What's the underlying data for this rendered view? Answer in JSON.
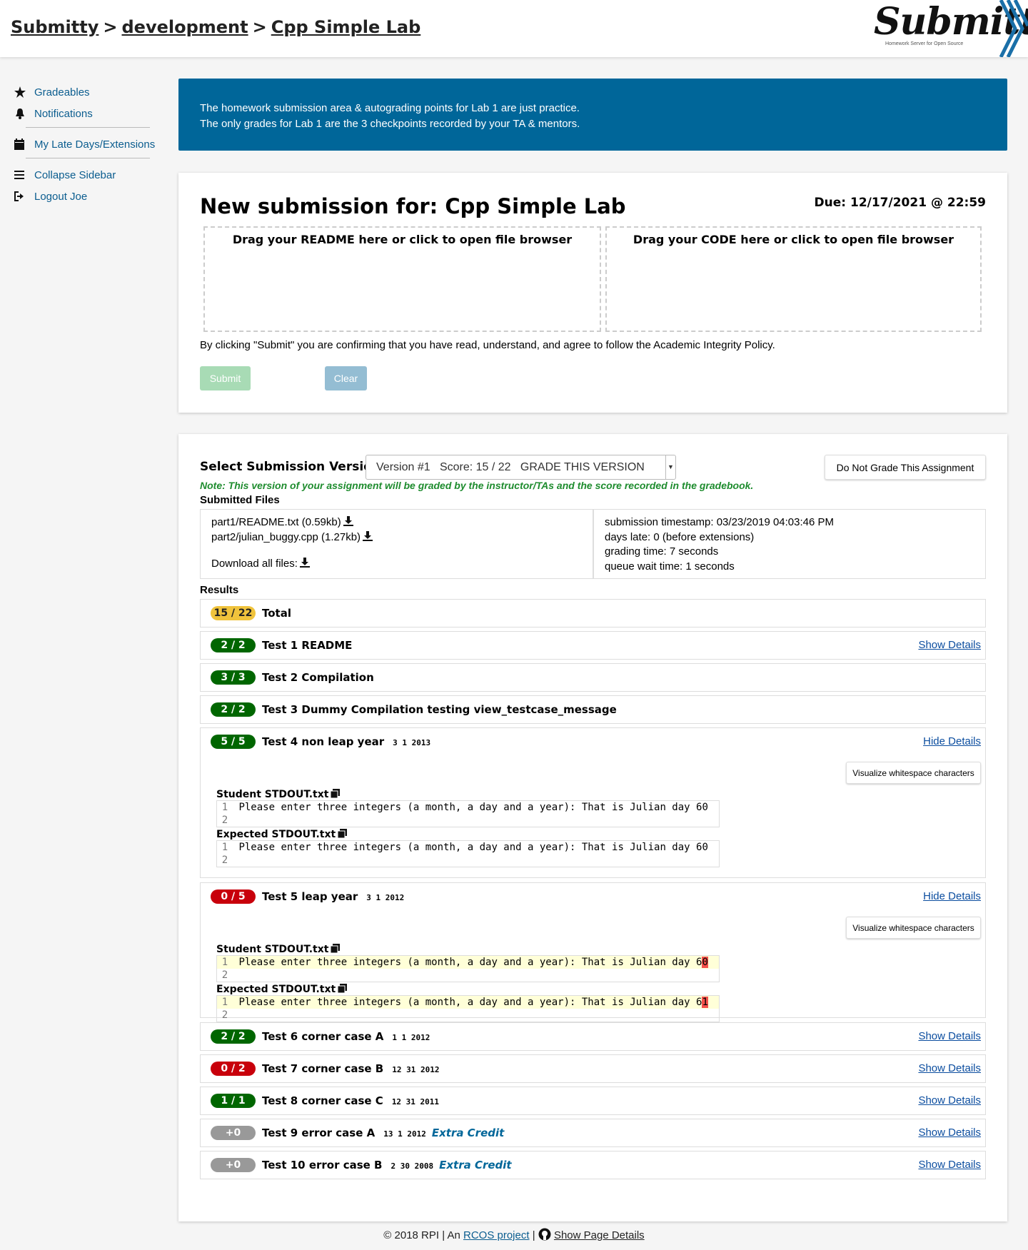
{
  "breadcrumb": {
    "course_site": "Submitty",
    "course": "development",
    "gradeable": "Cpp Simple Lab",
    "separator": ">"
  },
  "logo": {
    "text": "Submitty",
    "tagline": "Homework Server for Open Source"
  },
  "sidebar": {
    "items": [
      {
        "label": "Gradeables",
        "icon": "star-icon"
      },
      {
        "label": "Notifications",
        "icon": "bell-icon"
      },
      {
        "label": "My Late Days/Extensions",
        "icon": "calendar-icon"
      },
      {
        "label": "Collapse Sidebar",
        "icon": "menu-icon"
      },
      {
        "label": "Logout Joe",
        "icon": "sign-out-icon"
      }
    ]
  },
  "banner": {
    "line1": "The homework submission area & autograding points for Lab 1 are just practice.",
    "line2": "The only grades for Lab 1 are the 3 checkpoints recorded by your TA & mentors."
  },
  "submission": {
    "title": "New submission for: Cpp Simple Lab",
    "due": "Due: 12/17/2021 @ 22:59",
    "drop_readme": "Drag your README here or click to open file browser",
    "drop_code": "Drag your CODE here or click to open file browser",
    "agreement": "By clicking \"Submit\" you are confirming that you have read, understand, and agree to follow the Academic Integrity Policy.",
    "submit_label": "Submit",
    "clear_label": "Clear"
  },
  "version": {
    "select_label": "Select Submission Version:",
    "selected": "Version #1   Score: 15 / 22   GRADE THIS VERSION",
    "do_not_grade": "Do Not Grade This Assignment",
    "note": "Note: This version of your assignment will be graded by the instructor/TAs and the score recorded in the gradebook."
  },
  "files": {
    "label": "Submitted Files",
    "list": [
      "part1/README.txt (0.59kb)",
      "part2/julian_buggy.cpp (1.27kb)"
    ],
    "download_all": "Download all files:",
    "timestamp": "submission timestamp: 03/23/2019 04:03:46 PM",
    "days_late": "days late: 0 (before extensions)",
    "grading_time": "grading time: 7 seconds",
    "queue_time": "queue wait time: 1 seconds"
  },
  "results": {
    "label": "Results",
    "total": {
      "score": "15 / 22",
      "name": "Total"
    },
    "tests": [
      {
        "score": "2 / 2",
        "name": "Test 1 README",
        "args": "",
        "extra": "",
        "link": "Show Details"
      },
      {
        "score": "3 / 3",
        "name": "Test 2 Compilation",
        "args": "",
        "extra": "",
        "link": ""
      },
      {
        "score": "2 / 2",
        "name": "Test 3 Dummy Compilation testing view_testcase_message",
        "args": "",
        "extra": "",
        "link": ""
      },
      {
        "score": "5 / 5",
        "name": "Test 4 non leap year",
        "args": "3 1 2013",
        "extra": "",
        "link": "Hide Details"
      },
      {
        "score": "0 / 5",
        "name": "Test 5 leap year",
        "args": "3 1 2012",
        "extra": "",
        "link": "Hide Details"
      },
      {
        "score": "2 / 2",
        "name": "Test 6 corner case A",
        "args": "1 1 2012",
        "extra": "",
        "link": "Show Details"
      },
      {
        "score": "0 / 2",
        "name": "Test 7 corner case B",
        "args": "12 31 2012",
        "extra": "",
        "link": "Show Details"
      },
      {
        "score": "1 / 1",
        "name": "Test 8 corner case C",
        "args": "12 31 2011",
        "extra": "",
        "link": "Show Details"
      },
      {
        "score": "+0",
        "name": "Test 9 error case A",
        "args": "13 1 2012",
        "extra": "Extra Credit",
        "link": "Show Details"
      },
      {
        "score": "+0",
        "name": "Test 10 error case B",
        "args": "2 30 2008",
        "extra": "Extra Credit",
        "link": "Show Details"
      }
    ],
    "visualize_label": "Visualize whitespace characters",
    "student_out": "Student STDOUT.txt",
    "expected_out": "Expected STDOUT.txt",
    "line_numbers": [
      "1",
      "2"
    ],
    "out_prefix": "Please enter three integers (a month, a day and a year): That is Julian day ",
    "t4_student": "60",
    "t4_expected": "60",
    "t5_student_a": "6",
    "t5_student_b": "0",
    "t5_expected_a": "6",
    "t5_expected_b": "1"
  },
  "footer": {
    "copyright": "© 2018 RPI | An",
    "rcos": "RCOS project",
    "divider": "|",
    "page_details": "Show Page Details"
  },
  "colors": {
    "primary": "#006699",
    "green": "#006600",
    "red": "#c8000b",
    "yellow": "#f0c33c",
    "gray": "#999999"
  }
}
